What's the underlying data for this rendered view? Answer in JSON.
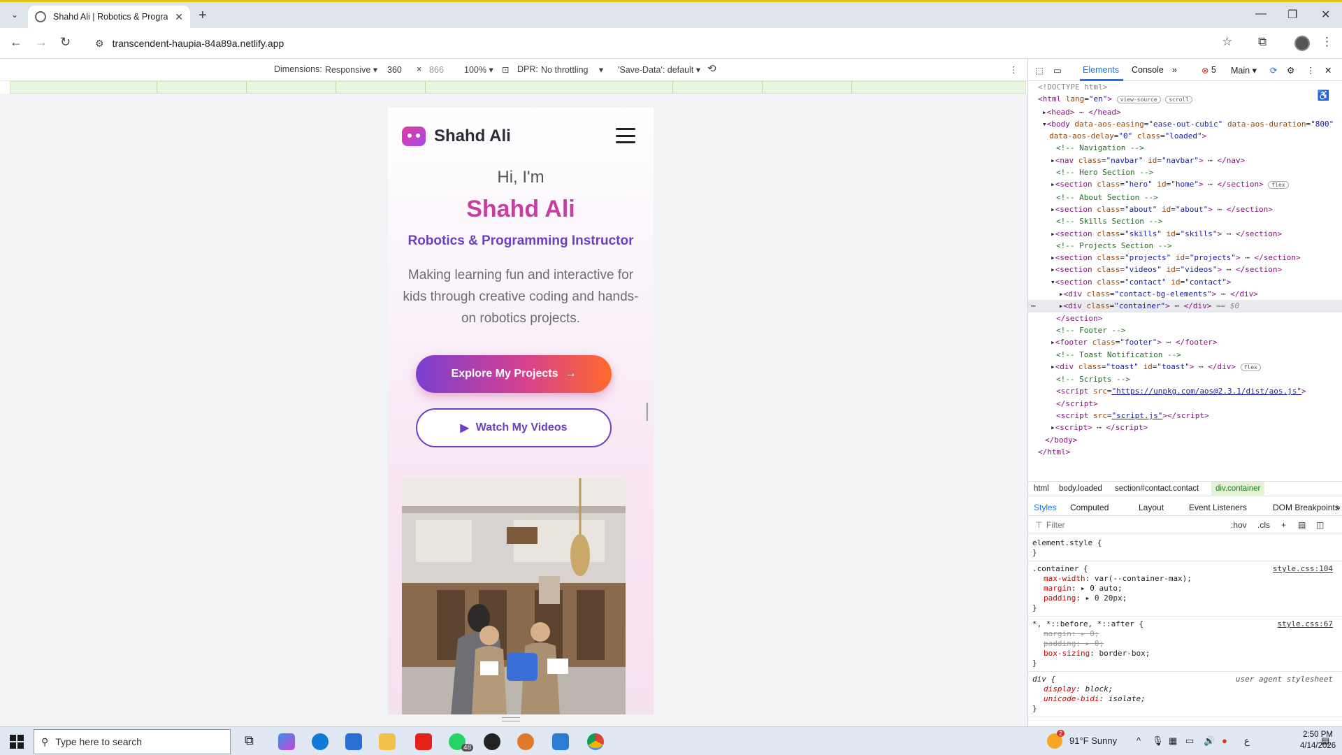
{
  "browser": {
    "tab_title": "Shahd Ali | Robotics & Program",
    "url": "transcendent-haupia-84a89a.netlify.app"
  },
  "device_toolbar": {
    "dimensions_label": "Dimensions:",
    "mode": "Responsive",
    "width": "360",
    "times": "×",
    "height": "866",
    "zoom": "100%",
    "dpr_label": "DPR:",
    "throttling": "No throttling",
    "save_data": "'Save-Data': default"
  },
  "site": {
    "brand": "Shahd Ali",
    "greeting": "Hi, I'm",
    "name": "Shahd Ali",
    "title": "Robotics & Programming Instructor",
    "description": "Making learning fun and interactive for kids through creative coding and hands-on robotics projects.",
    "primary_button": "Explore My Projects",
    "secondary_button": "Watch My Videos"
  },
  "devtools": {
    "tabs": [
      "Elements",
      "Console"
    ],
    "error_count": "5",
    "context": "Main",
    "breadcrumbs": [
      "html",
      "body.loaded",
      "section#contact.contact",
      "div.container"
    ],
    "style_tabs": [
      "Styles",
      "Computed",
      "Layout",
      "Event Listeners",
      "DOM Breakpoints"
    ],
    "filter_placeholder": "Filter",
    "filter_tools": [
      ":hov",
      ".cls"
    ],
    "rules": {
      "element_style": "element.style {",
      "container_selector": ".container {",
      "container_src": "style.css:104",
      "universal_selector": "*, *::before, *::after {",
      "universal_src": "style.css:67",
      "div_selector": "div {",
      "div_src": "user agent stylesheet"
    }
  },
  "taskbar": {
    "search_placeholder": "Type here to search",
    "weather": "91°F  Sunny",
    "time": "2:50 PM",
    "date": "4/14/2026",
    "whatsapp_badge": "48",
    "weather_badge": "2"
  },
  "colors": {
    "accent_pink": "#c53fa0",
    "accent_purple": "#6c3fc0",
    "devtools_blue": "#1a73e8"
  }
}
